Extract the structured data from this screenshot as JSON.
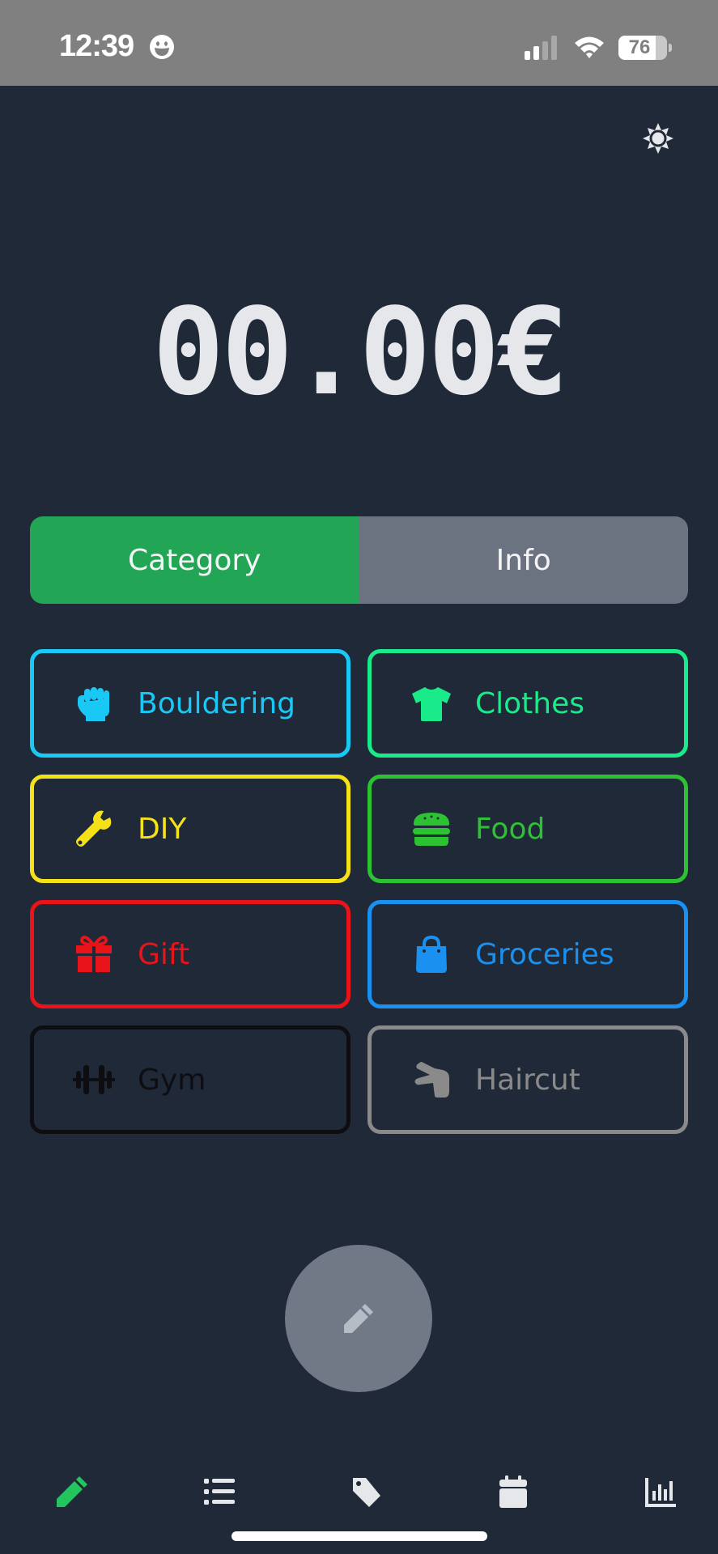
{
  "status_bar": {
    "time": "12:39",
    "battery_level": "76",
    "battery_fraction": 0.76,
    "signal_bars_active": 2,
    "signal_bars_total": 4
  },
  "header": {
    "settings_icon": "sun-icon"
  },
  "amount": {
    "value": "00.00€"
  },
  "tabs": [
    {
      "label": "Category",
      "active": true
    },
    {
      "label": "Info",
      "active": false
    }
  ],
  "categories": [
    {
      "label": "Bouldering",
      "icon": "fist-icon",
      "color": "#1ac8f5"
    },
    {
      "label": "Clothes",
      "icon": "tshirt-icon",
      "color": "#1aeb8a"
    },
    {
      "label": "DIY",
      "icon": "wrench-icon",
      "color": "#f5e11a"
    },
    {
      "label": "Food",
      "icon": "burger-icon",
      "color": "#2cc232"
    },
    {
      "label": "Gift",
      "icon": "gift-icon",
      "color": "#e8141a"
    },
    {
      "label": "Groceries",
      "icon": "shopping-bag-icon",
      "color": "#1a90f0"
    },
    {
      "label": "Gym",
      "icon": "dumbbell-icon",
      "color": "#0e0e12"
    },
    {
      "label": "Haircut",
      "icon": "hand-scissors-icon",
      "color": "#8a8a8a"
    }
  ],
  "fab": {
    "icon": "pencil-icon"
  },
  "bottom_nav": [
    {
      "name": "edit",
      "icon": "pencil-icon",
      "active": true
    },
    {
      "name": "list",
      "icon": "list-icon",
      "active": false
    },
    {
      "name": "tags",
      "icon": "tag-icon",
      "active": false
    },
    {
      "name": "calendar",
      "icon": "calendar-icon",
      "active": false
    },
    {
      "name": "stats",
      "icon": "bar-chart-icon",
      "active": false
    }
  ],
  "colors": {
    "background": "#1f2937",
    "accent_green": "#22a655",
    "nav_active": "#22c55e",
    "nav_inactive": "#e5e7eb",
    "tab_inactive": "#6b7280",
    "fab": "#717986",
    "fab_icon": "#b6bcc6"
  }
}
